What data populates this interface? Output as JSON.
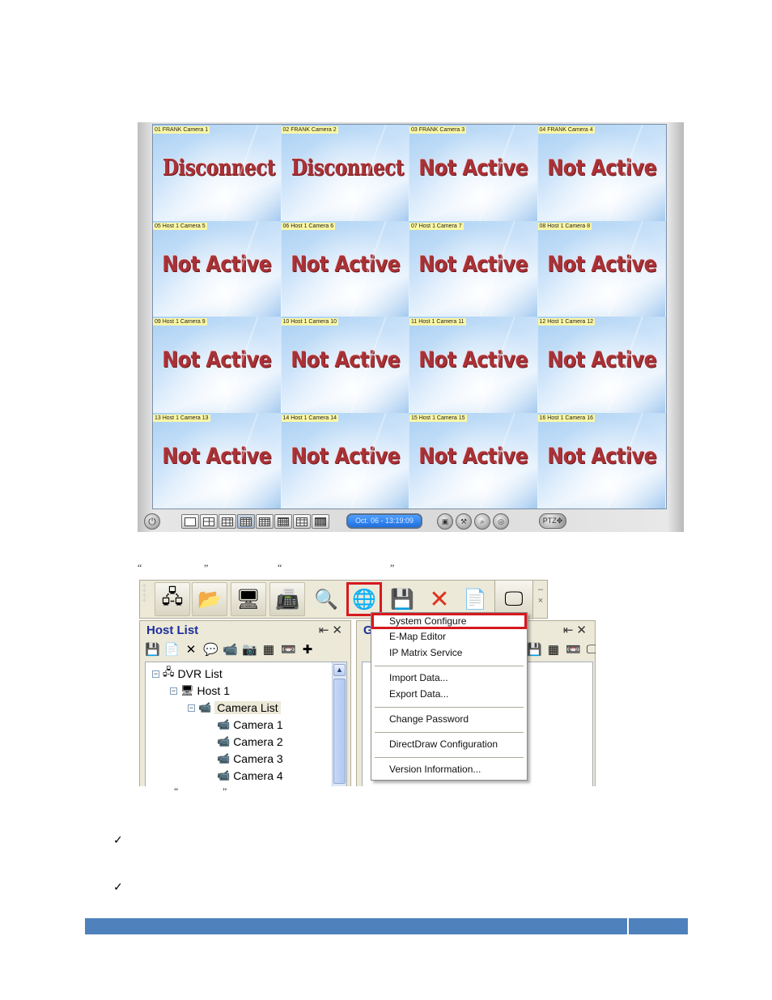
{
  "camera_grid": {
    "cells": [
      {
        "label": "01 FRANK Camera 1",
        "status": "Disconnect"
      },
      {
        "label": "02 FRANK Camera 2",
        "status": "Disconnect"
      },
      {
        "label": "03 FRANK Camera 3",
        "status": "Not Active"
      },
      {
        "label": "04 FRANK Camera 4",
        "status": "Not Active"
      },
      {
        "label": "05 Host 1 Camera 5",
        "status": "Not Active"
      },
      {
        "label": "06 Host 1 Camera 6",
        "status": "Not Active"
      },
      {
        "label": "07 Host 1 Camera 7",
        "status": "Not Active"
      },
      {
        "label": "08 Host 1 Camera 8",
        "status": "Not Active"
      },
      {
        "label": "09 Host 1 Camera 9",
        "status": "Not Active"
      },
      {
        "label": "10 Host 1 Camera 10",
        "status": "Not Active"
      },
      {
        "label": "11 Host 1 Camera 11",
        "status": "Not Active"
      },
      {
        "label": "12 Host 1 Camera 12",
        "status": "Not Active"
      },
      {
        "label": "13 Host 1 Camera 13",
        "status": "Not Active"
      },
      {
        "label": "14 Host 1 Camera 14",
        "status": "Not Active"
      },
      {
        "label": "15 Host 1 Camera 15",
        "status": "Not Active"
      },
      {
        "label": "16 Host 1 Camera 16",
        "status": "Not Active"
      }
    ],
    "toolbar": {
      "power_icon": "power-icon",
      "layouts": [
        "1-split",
        "4-split",
        "9-split",
        "16-split",
        "13-split",
        "25-split",
        "sequence",
        "36-split"
      ],
      "active_layout": "16-split",
      "datetime": "Oct. 06 - 13:19:09",
      "round_buttons": [
        "snapshot-icon",
        "tools-icon",
        "zoom-icon",
        "record-icon"
      ],
      "ptz_label": "PTZ✥"
    }
  },
  "quotes": [
    "“",
    "”",
    "“",
    "”",
    "“",
    "”"
  ],
  "app_window": {
    "toolbar_buttons": [
      {
        "icon": "host-tree-icon",
        "glyph": "🖧"
      },
      {
        "icon": "folder-icon",
        "glyph": "📂"
      },
      {
        "icon": "network-computers-icon",
        "glyph": "🖥"
      },
      {
        "icon": "device-icon",
        "glyph": "📠"
      },
      {
        "icon": "search-icon",
        "glyph": "🔍"
      },
      {
        "icon": "system-tools-icon",
        "glyph": "🌐"
      },
      {
        "icon": "save-icon",
        "glyph": "💾"
      },
      {
        "icon": "delete-icon",
        "glyph": "✕"
      },
      {
        "icon": "new-icon",
        "glyph": "📄"
      },
      {
        "icon": "monitor-icon",
        "glyph": "🖵"
      }
    ],
    "toolbar_mini": [
      "–",
      "×"
    ],
    "host_panel": {
      "title": "Host List",
      "controls": [
        "⇤",
        "✕"
      ],
      "tools": [
        "💾",
        "📄",
        "✕",
        "💬",
        "📹",
        "📷",
        "▦",
        "📼",
        "✚"
      ],
      "tree": [
        {
          "label": "DVR List",
          "icon": "🖧",
          "expander": "−",
          "level": 0
        },
        {
          "label": "Host 1",
          "icon": "🖥",
          "expander": "−",
          "level": 1
        },
        {
          "label": "Camera List",
          "icon": "📹",
          "expander": "−",
          "level": 2,
          "selected": true
        },
        {
          "label": "Camera 1",
          "icon": "📹",
          "level": 3
        },
        {
          "label": "Camera 2",
          "icon": "📹",
          "level": 3
        },
        {
          "label": "Camera 3",
          "icon": "📹",
          "level": 3
        },
        {
          "label": "Camera 4",
          "icon": "📹",
          "level": 3
        }
      ]
    },
    "right_panel": {
      "title_partial": "G",
      "controls": [
        "⇤",
        "✕"
      ],
      "tools": [
        "💾",
        "▦",
        "📼",
        "🖵"
      ]
    },
    "context_menu": {
      "highlight_color": "#d7191f",
      "groups": [
        [
          "System Configure",
          "E-Map Editor",
          "IP Matrix Service"
        ],
        [
          "Import Data...",
          "Export Data..."
        ],
        [
          "Change Password"
        ],
        [
          "DirectDraw Configuration"
        ],
        [
          "Version Information..."
        ]
      ]
    }
  },
  "bullets": [
    "✓",
    "✓"
  ],
  "footer": {
    "color": "#4f81bd"
  }
}
